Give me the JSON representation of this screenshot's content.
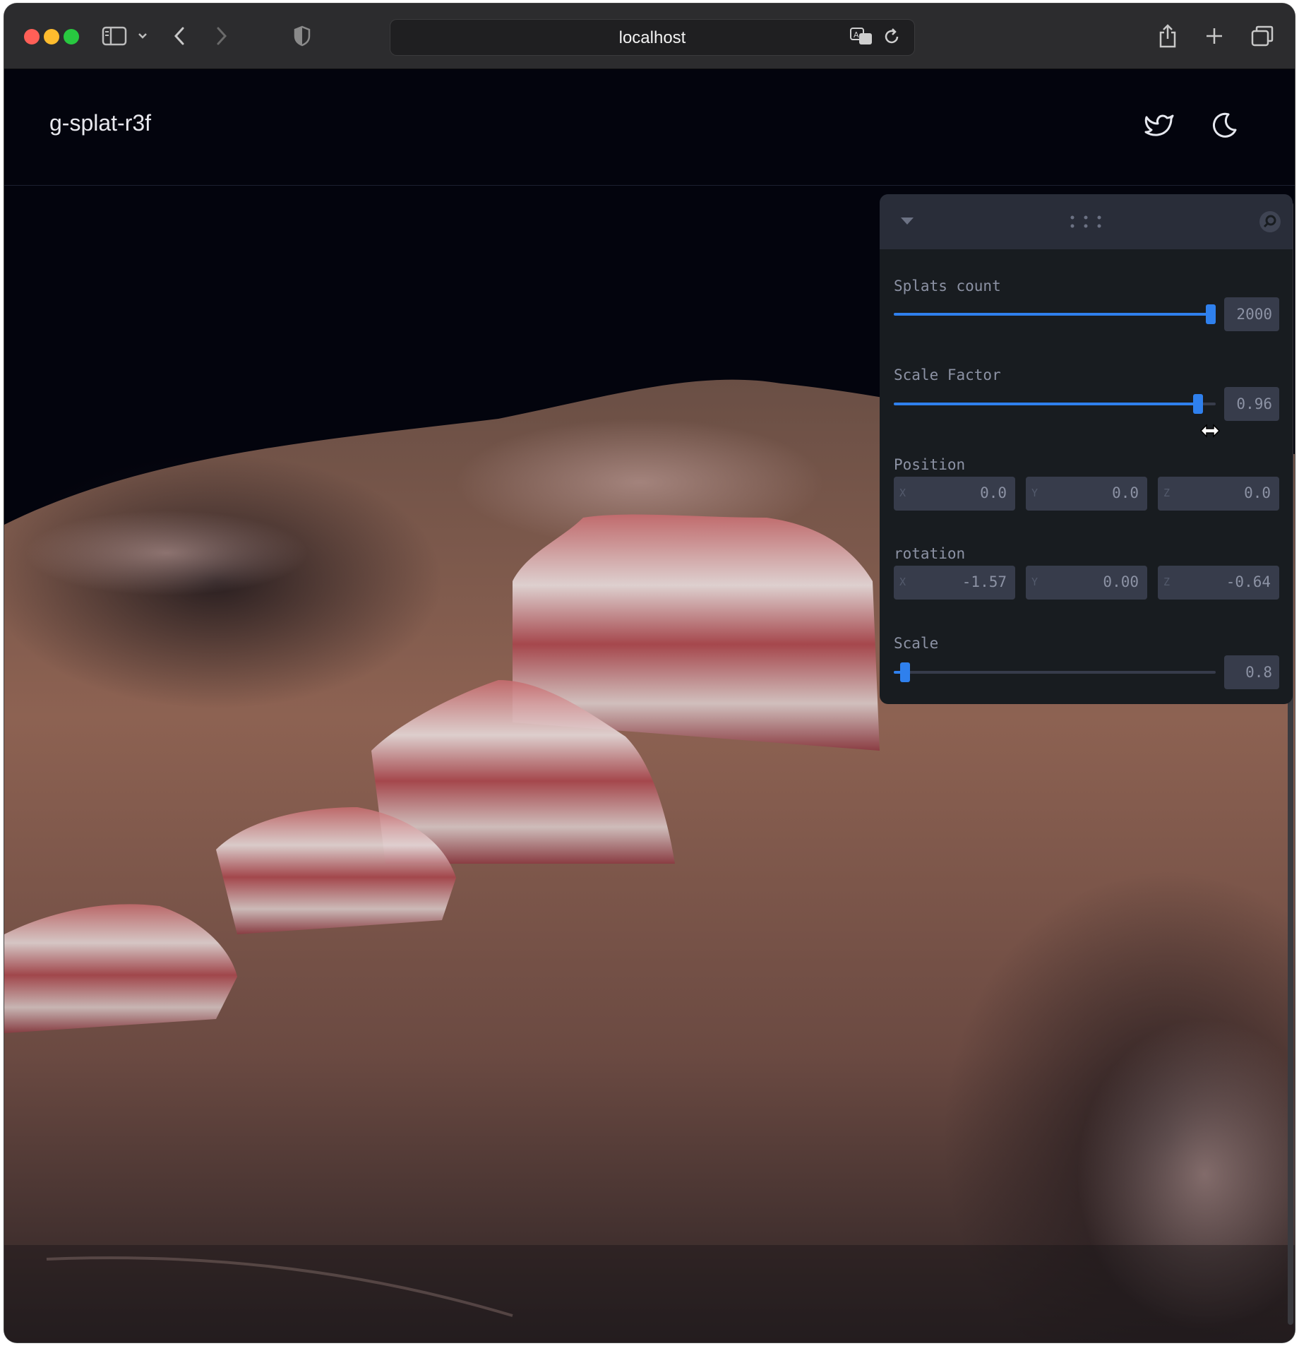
{
  "browser": {
    "url": "localhost"
  },
  "app": {
    "title": "g-splat-r3f"
  },
  "controls": {
    "splats_count": {
      "label": "Splats count",
      "value": "2000",
      "fraction": 0.985
    },
    "scale_factor": {
      "label": "Scale Factor",
      "value": "0.96",
      "fraction": 0.945
    },
    "position": {
      "label": "Position",
      "x": "0.0",
      "y": "0.0",
      "z": "0.0",
      "axes": [
        "X",
        "Y",
        "Z"
      ]
    },
    "rotation": {
      "label": "rotation",
      "x": "-1.57",
      "y": "0.00",
      "z": "-0.64",
      "axes": [
        "X",
        "Y",
        "Z"
      ]
    },
    "scale": {
      "label": "Scale",
      "value": "0.8",
      "fraction": 0.035
    }
  },
  "colors": {
    "accent": "#2f80ed",
    "panel_bg": "#181c20",
    "panel_header": "#292d39",
    "field_bg": "#373c4b",
    "page_bg": "#03040d"
  },
  "icons": [
    "sidebar-icon",
    "chevron-down-icon",
    "back-icon",
    "forward-icon",
    "shield-icon",
    "translate-icon",
    "reload-icon",
    "share-icon",
    "new-tab-icon",
    "tabs-icon",
    "twitter-icon",
    "moon-icon",
    "collapse-icon",
    "drag-handle-icon",
    "search-icon",
    "resize-cursor-icon"
  ]
}
